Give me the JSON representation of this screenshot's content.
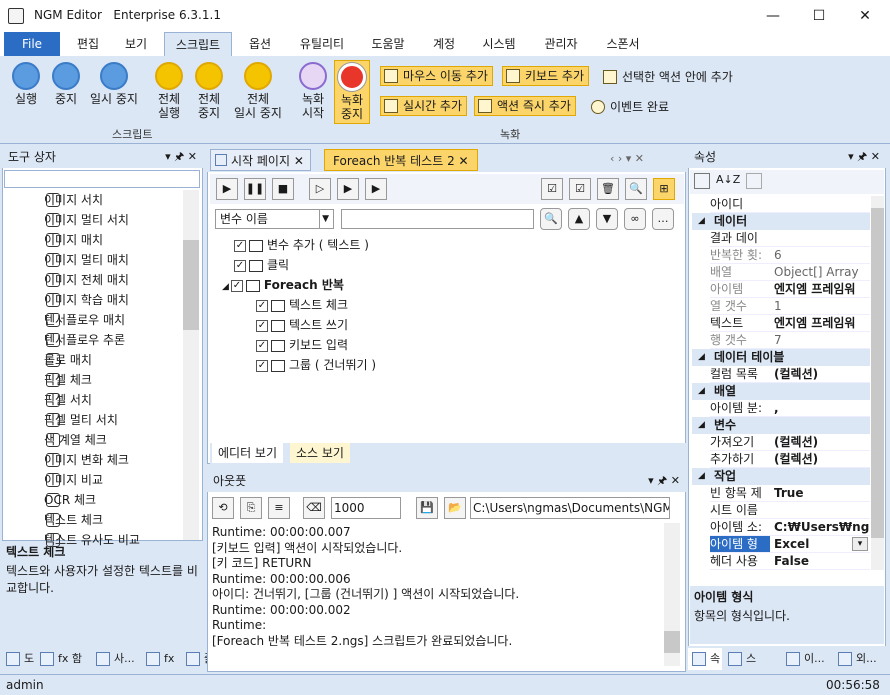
{
  "app": {
    "title": "NGM Editor",
    "edition": "Enterprise 6.3.1.1",
    "minimize": "—",
    "maximize": "☐",
    "close": "✕"
  },
  "ribbon_tabs": [
    "File",
    "편집",
    "보기",
    "스크립트",
    "옵션",
    "유틸리티",
    "도움말",
    "계정",
    "시스템",
    "관리자",
    "스폰서"
  ],
  "script_group": {
    "label": "스크립트",
    "run": "실행",
    "stop": "중지",
    "pause": "일시 중지",
    "run_all": "전체\n실행",
    "stop_all": "전체\n중지",
    "pause_all": "전체\n일시 중지"
  },
  "record_group": {
    "label": "녹화",
    "start": "녹화\n시작",
    "stop": "녹화\n중지",
    "mouse_move": "마우스 이동 추가",
    "keyboard": "키보드 추가",
    "selected_action": "선택한 액션 안에 추가",
    "realtime": "실시간 추가",
    "action_now": "액션 즉시 추가",
    "event_done": "이벤트 완료"
  },
  "toolbox": {
    "title": "도구 상자",
    "items": [
      "이미지 서치",
      "이미지 멀티 서치",
      "이미지 매치",
      "이미지 멀티 매치",
      "이미지 전체 매치",
      "이미지 학습 매치",
      "텐서플로우 매치",
      "텐서플로우 추론",
      "롤로 매치",
      "픽셀 체크",
      "픽셀 서치",
      "픽셀 멀티 서치",
      "색 계열 체크",
      "이미지 변화 체크",
      "이미지 비교",
      "OCR 체크",
      "텍스트 체크",
      "텍스트 유사도 비교"
    ],
    "desc_title": "텍스트 체크",
    "desc_text": "텍스트와 사용자가 설정한 텍스트를 비교합니다.",
    "bottom_tabs": [
      "도",
      "fx 함",
      "사...",
      "fx 사...",
      "즐"
    ]
  },
  "editor": {
    "tabs": [
      "시작 페이지",
      "Foreach 반복 테스트 2"
    ],
    "var_select": "변수 이름",
    "tree": [
      "변수 추가 ( 텍스트 )",
      "클릭",
      "Foreach 반복",
      "텍스트 체크",
      "텍스트 쓰기",
      "키보드 입력",
      "그룹 ( 건너뛰기 )"
    ],
    "view_tabs": [
      "에디터 보기",
      "소스 보기"
    ]
  },
  "output": {
    "title": "아웃풋",
    "count": "1000",
    "path": "C:\\Users\\ngmas\\Documents\\NGM6\\",
    "lines": [
      "Runtime: 00:00:00.007",
      "[키보드 입력] 액션이 시작되었습니다.",
      "[키 코드] RETURN",
      "Runtime: 00:00:00.006",
      "아이디: 건너뛰기, [그룹 (건너뛰기) ] 액션이 시작되었습니다.",
      "Runtime: 00:00:00.002",
      "Runtime:",
      "[Foreach 반복 테스트 2.ngs] 스크립트가 완료되었습니다."
    ]
  },
  "properties": {
    "title": "속성",
    "rows": [
      {
        "t": "r",
        "n": "아이디",
        "v": ""
      },
      {
        "t": "c",
        "n": "데이터"
      },
      {
        "t": "r",
        "n": "결과 데이",
        "v": ""
      },
      {
        "t": "r",
        "n": "반복한 횟:",
        "v": "6",
        "g": true
      },
      {
        "t": "r",
        "n": "배열",
        "v": "Object[] Array",
        "g": true
      },
      {
        "t": "r",
        "n": "아이템",
        "v": "엔지엠 프레임워",
        "g": true
      },
      {
        "t": "r",
        "n": "열 갯수",
        "v": "1",
        "g": true
      },
      {
        "t": "r",
        "n": "텍스트",
        "v": "엔지엠 프레임워"
      },
      {
        "t": "r",
        "n": "행 갯수",
        "v": "7",
        "g": true
      },
      {
        "t": "c",
        "n": "데이터 테이블"
      },
      {
        "t": "r",
        "n": "컬럼 목록",
        "v": "(컬렉션)"
      },
      {
        "t": "c",
        "n": "배열"
      },
      {
        "t": "r",
        "n": "아이템 분:",
        "v": ","
      },
      {
        "t": "c",
        "n": "변수"
      },
      {
        "t": "r",
        "n": "가져오기",
        "v": "(컬렉션)"
      },
      {
        "t": "r",
        "n": "추가하기",
        "v": "(컬렉션)"
      },
      {
        "t": "c",
        "n": "작업"
      },
      {
        "t": "r",
        "n": "빈 항목 제",
        "v": "True"
      },
      {
        "t": "r",
        "n": "시트 이름",
        "v": ""
      },
      {
        "t": "r",
        "n": "아이템 소:",
        "v": "C:₩Users₩ngr"
      },
      {
        "t": "r",
        "n": "아이템 형",
        "v": "Excel",
        "sel": true
      },
      {
        "t": "r",
        "n": "헤더 사용",
        "v": "False"
      }
    ],
    "desc_title": "아이템 형식",
    "desc_text": "항목의 형식입니다.",
    "bottom_tabs": [
      "속",
      "스크...",
      "이...",
      "외..."
    ]
  },
  "status": {
    "user": "admin",
    "time": "00:56:58"
  }
}
